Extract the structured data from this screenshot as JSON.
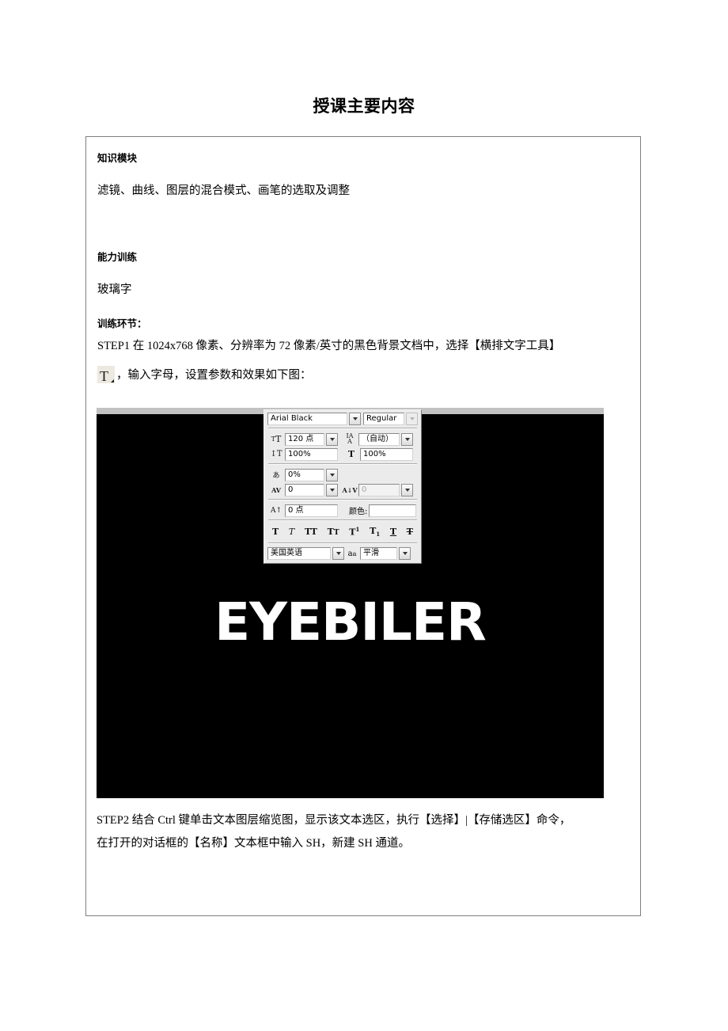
{
  "page": {
    "title": "授课主要内容"
  },
  "content": {
    "module_heading": "知识模块",
    "module_text": "滤镜、曲线、图层的混合模式、画笔的选取及调整",
    "ability_heading": "能力训练",
    "ability_text": "玻璃字",
    "training_heading": "训练环节：",
    "step1_text": "STEP1 在 1024x768 像素、分辨率为 72 像素/英寸的黑色背景文档中，选择【横排文字工具】",
    "step1_cont": "，输入字母，设置参数和效果如下图：",
    "t_tool_glyph": "T",
    "step2_line1": "STEP2 结合 Ctrl 键单击文本图层缩览图，显示该文本选区，执行【选择】|【存储选区】命令，",
    "step2_line2": "在打开的对话框的【名称】文本框中输入 SH，新建 SH 通道。"
  },
  "figure": {
    "canvas_text": "EYEBILER",
    "canvas_bg": "#000000",
    "canvas_text_color": "#ffffff",
    "topband_color": "#c2c2c2"
  },
  "character_panel": {
    "font_family": "Arial Black",
    "font_style": "Regular",
    "font_size": "120 点",
    "leading": "（自动）",
    "vertical_scale": "100%",
    "horizontal_scale": "100%",
    "tsume": "0%",
    "tracking": "0",
    "kerning": "0",
    "baseline_shift": "0 点",
    "color_label": "颜色:",
    "color_value": "#ffffff",
    "language": "美国英语",
    "antialias": "平滑",
    "style_buttons": [
      {
        "name": "faux-bold",
        "glyph": "T"
      },
      {
        "name": "faux-italic",
        "glyph": "T"
      },
      {
        "name": "all-caps",
        "glyph": "TT"
      },
      {
        "name": "small-caps",
        "glyph": "TT"
      },
      {
        "name": "superscript",
        "glyph": "T"
      },
      {
        "name": "subscript",
        "glyph": "T"
      },
      {
        "name": "underline",
        "glyph": "T"
      },
      {
        "name": "strikethrough",
        "glyph": "T"
      }
    ],
    "icons": {
      "size": "size-icon",
      "leading": "leading-icon",
      "vscale": "vertical-scale-icon",
      "hscale": "horizontal-scale-icon",
      "tsume": "tsume-icon",
      "tracking": "tracking-icon",
      "kerning": "kerning-icon",
      "baseline": "baseline-shift-icon",
      "antialias": "anti-alias-icon"
    }
  }
}
